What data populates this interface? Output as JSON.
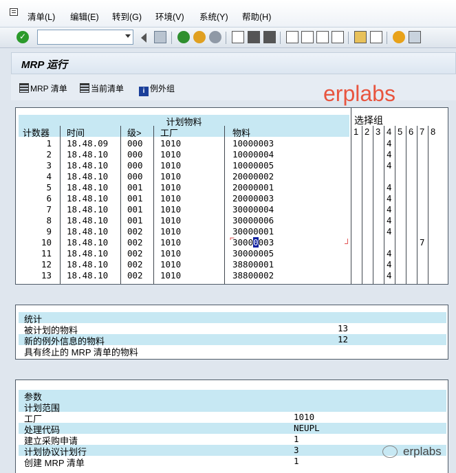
{
  "menu": [
    "清单(L)",
    "编辑(E)",
    "转到(G)",
    "环境(V)",
    "系统(Y)",
    "帮助(H)"
  ],
  "title": "MRP 运行",
  "app_buttons": [
    "MRP 清单",
    "当前清单",
    "例外组"
  ],
  "watermark": "erplabs",
  "planned": {
    "title": "计划物料",
    "headers": [
      "计数器",
      "时间",
      "级>",
      "工厂",
      "物料"
    ],
    "rows": [
      {
        "n": "1",
        "time": "18.48.09",
        "lvl": "000",
        "plant": "1010",
        "mat": "10000003",
        "g4": "4",
        "g7": ""
      },
      {
        "n": "2",
        "time": "18.48.10",
        "lvl": "000",
        "plant": "1010",
        "mat": "10000004",
        "g4": "4",
        "g7": ""
      },
      {
        "n": "3",
        "time": "18.48.10",
        "lvl": "000",
        "plant": "1010",
        "mat": "10000005",
        "g4": "4",
        "g7": ""
      },
      {
        "n": "4",
        "time": "18.48.10",
        "lvl": "000",
        "plant": "1010",
        "mat": "20000002",
        "g4": "",
        "g7": ""
      },
      {
        "n": "5",
        "time": "18.48.10",
        "lvl": "001",
        "plant": "1010",
        "mat": "20000001",
        "g4": "4",
        "g7": ""
      },
      {
        "n": "6",
        "time": "18.48.10",
        "lvl": "001",
        "plant": "1010",
        "mat": "20000003",
        "g4": "4",
        "g7": ""
      },
      {
        "n": "7",
        "time": "18.48.10",
        "lvl": "001",
        "plant": "1010",
        "mat": "30000004",
        "g4": "4",
        "g7": ""
      },
      {
        "n": "8",
        "time": "18.48.10",
        "lvl": "001",
        "plant": "1010",
        "mat": "30000006",
        "g4": "4",
        "g7": ""
      },
      {
        "n": "9",
        "time": "18.48.10",
        "lvl": "002",
        "plant": "1010",
        "mat": "30000001",
        "g4": "4",
        "g7": ""
      },
      {
        "n": "10",
        "time": "18.48.10",
        "lvl": "002",
        "plant": "1010",
        "mat": "30000003",
        "g4": "",
        "g7": "7"
      },
      {
        "n": "11",
        "time": "18.48.10",
        "lvl": "002",
        "plant": "1010",
        "mat": "30000005",
        "g4": "4",
        "g7": ""
      },
      {
        "n": "12",
        "time": "18.48.10",
        "lvl": "002",
        "plant": "1010",
        "mat": "38800001",
        "g4": "4",
        "g7": ""
      },
      {
        "n": "13",
        "time": "18.48.10",
        "lvl": "002",
        "plant": "1010",
        "mat": "38800002",
        "g4": "4",
        "g7": ""
      }
    ]
  },
  "selection": {
    "title": "选择组",
    "cols": [
      "1",
      "2",
      "3",
      "4",
      "5",
      "6",
      "7",
      "8"
    ]
  },
  "stats": {
    "title": "统计",
    "rows": [
      {
        "label": "被计划的物料",
        "value": "13"
      },
      {
        "label": "新的例外信息的物料",
        "value": "12"
      },
      {
        "label": "具有终止的 MRP 清单的物料",
        "value": ""
      }
    ]
  },
  "params": {
    "title": "参数",
    "rows": [
      {
        "label": "计划范围",
        "value": ""
      },
      {
        "label": "工厂",
        "value": "1010"
      },
      {
        "label": "处理代码",
        "value": "NEUPL"
      },
      {
        "label": "建立采购申请",
        "value": "1"
      },
      {
        "label": "计划协议计划行",
        "value": "3"
      },
      {
        "label": "创建 MRP 清单",
        "value": "1"
      }
    ]
  },
  "wechat": "erplabs"
}
